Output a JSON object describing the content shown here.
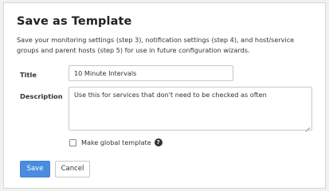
{
  "dialog": {
    "title": "Save as Template",
    "description": "Save your monitoring settings (step 3), notification settings (step 4), and host/service groups and parent hosts (step 5) for use in future configuration wizards."
  },
  "form": {
    "title_label": "Title",
    "title_value": "10 Minute Intervals",
    "description_label": "Description",
    "description_value": "Use this for services that don't need to be checked as often",
    "global_checkbox_label": "Make global template",
    "global_checkbox_checked": false,
    "help_icon": "question-circle-icon"
  },
  "buttons": {
    "save_label": "Save",
    "cancel_label": "Cancel"
  },
  "colors": {
    "primary": "#4a8de0",
    "background": "#f1f1f1",
    "panel": "#ffffff"
  }
}
